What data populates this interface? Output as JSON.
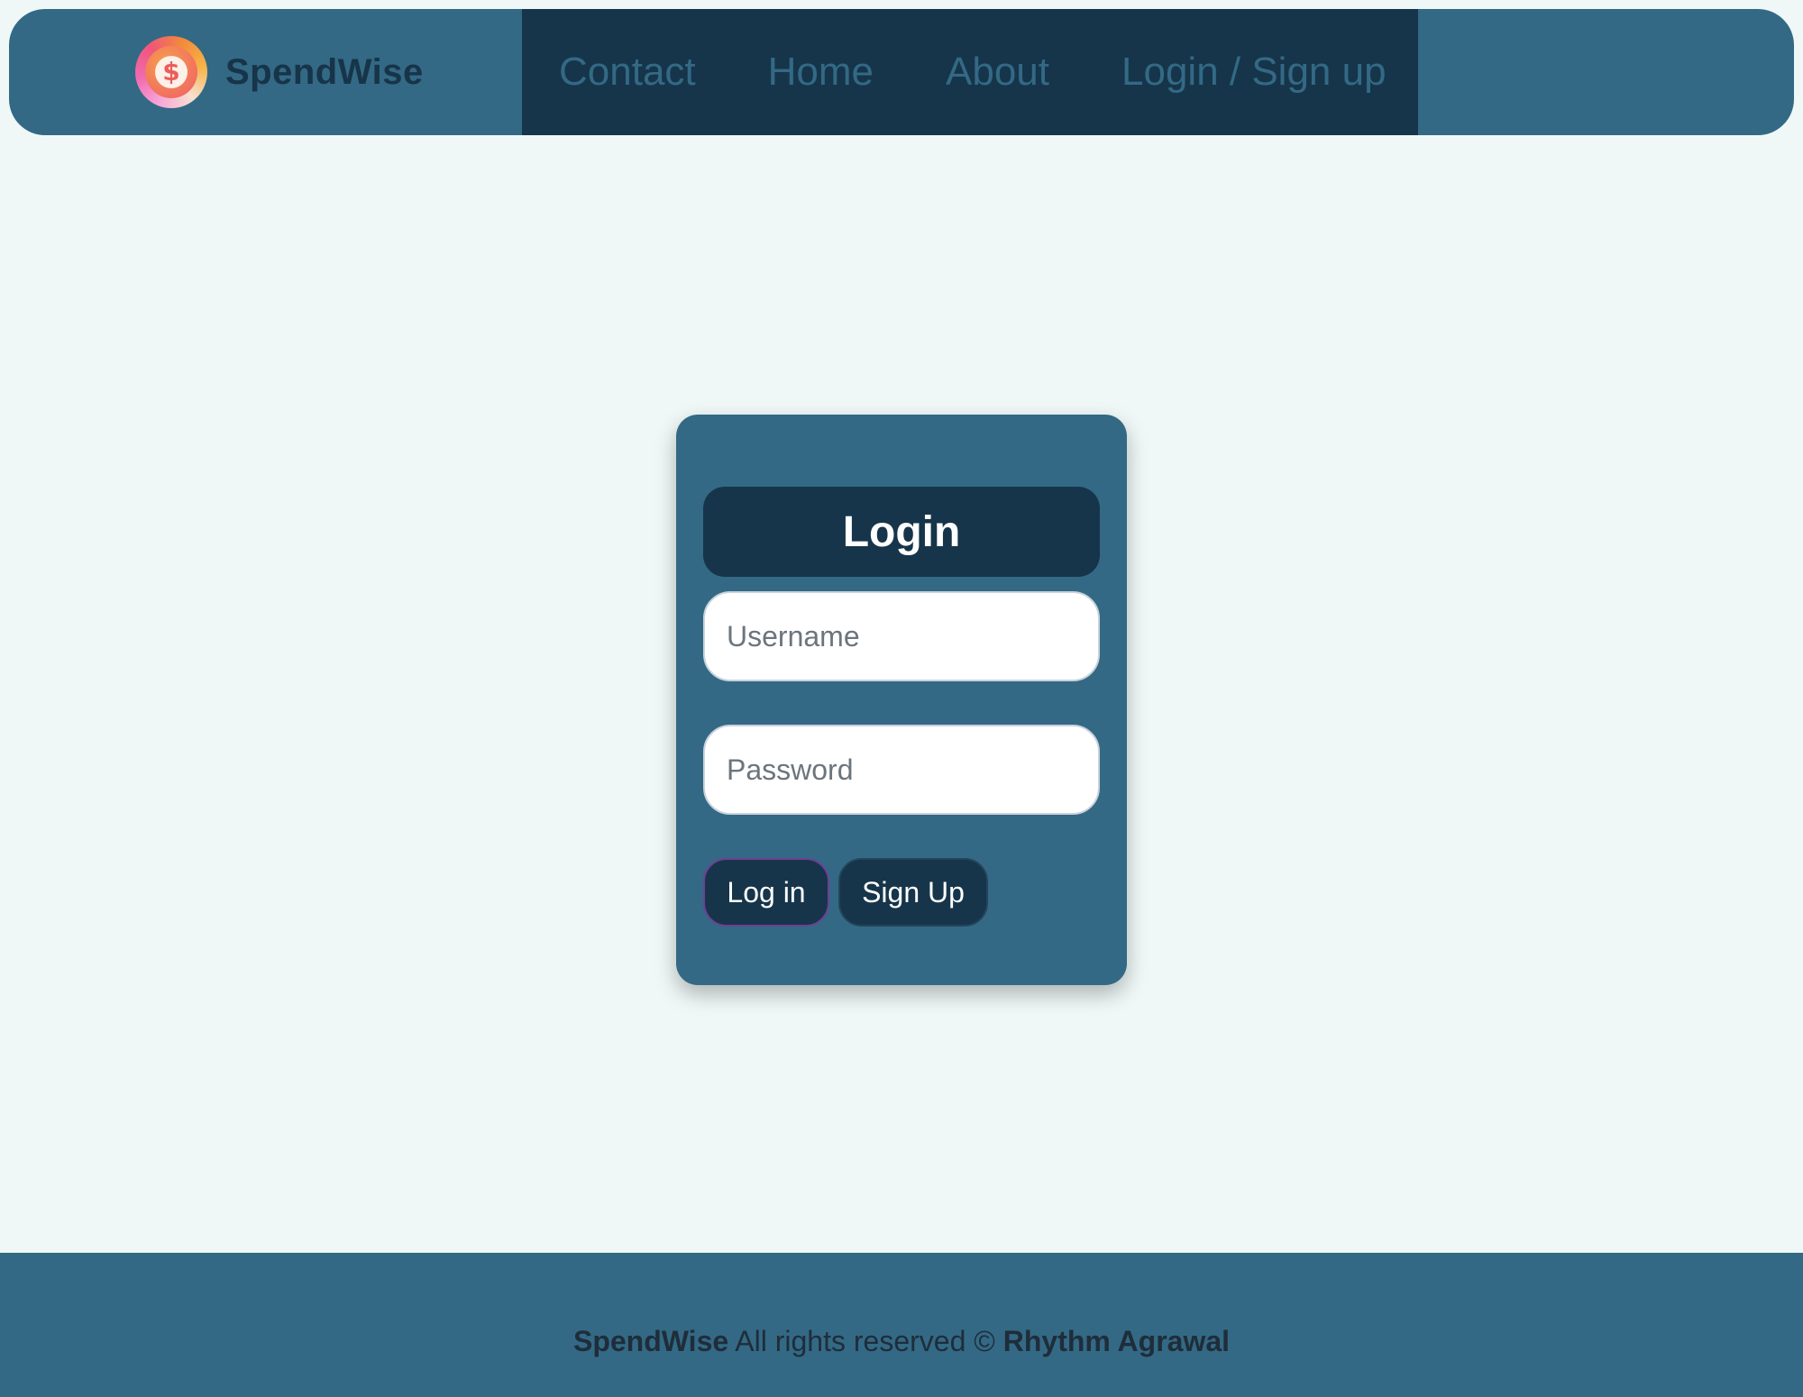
{
  "brand": {
    "name": "SpendWise",
    "logo_symbol": "$"
  },
  "nav": {
    "links": [
      "Contact",
      "Home",
      "About",
      "Login / Sign up"
    ]
  },
  "login": {
    "title": "Login",
    "username_placeholder": "Username",
    "password_placeholder": "Password",
    "login_button": "Log in",
    "signup_button": "Sign Up"
  },
  "footer": {
    "brand": "SpendWise",
    "rights": "All rights reserved ©",
    "author": "Rhythm Agrawal"
  },
  "colors": {
    "page_bg": "#eff8f7",
    "primary": "#336985",
    "dark": "#16354a"
  }
}
